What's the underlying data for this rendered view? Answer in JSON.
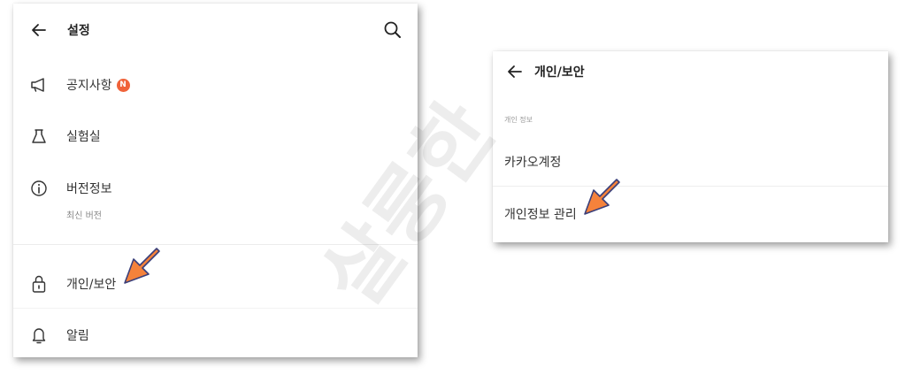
{
  "left_panel": {
    "title": "설정",
    "menu": [
      {
        "label": "공지사항",
        "badge": "N"
      },
      {
        "label": "실험실"
      },
      {
        "label": "버전정보",
        "sublabel": "최신 버전"
      },
      {
        "label": "개인/보안"
      },
      {
        "label": "알림"
      }
    ]
  },
  "right_panel": {
    "title": "개인/보안",
    "section_label": "개인 정보",
    "items": [
      {
        "label": "카카오계정"
      },
      {
        "label": "개인정보 관리"
      }
    ]
  },
  "watermark": "살룽한",
  "colors": {
    "badge": "#f0633a",
    "arrow_fill": "#f5823b",
    "arrow_stroke": "#3a3f7a"
  }
}
